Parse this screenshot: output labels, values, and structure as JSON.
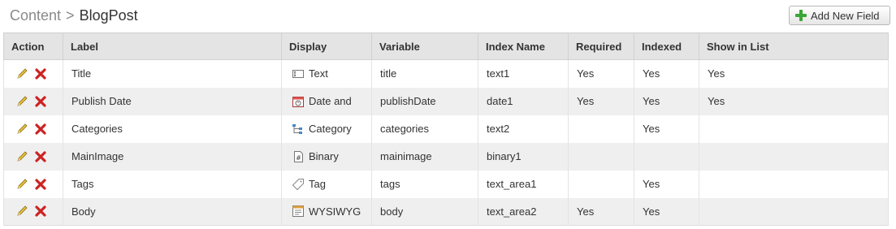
{
  "breadcrumb": {
    "root": "Content",
    "separator": ">",
    "current": "BlogPost"
  },
  "toolbar": {
    "add_new_field_label": "Add New Field",
    "add_icon": "plus-icon"
  },
  "table": {
    "headers": [
      "Action",
      "Label",
      "Display",
      "Variable",
      "Index Name",
      "Required",
      "Indexed",
      "Show in List"
    ],
    "rows": [
      {
        "label": "Title",
        "display": "Text",
        "display_icon": "text-field-icon",
        "variable": "title",
        "index_name": "text1",
        "required": "Yes",
        "indexed": "Yes",
        "show_in_list": "Yes"
      },
      {
        "label": "Publish Date",
        "display": "Date and",
        "display_icon": "calendar-icon",
        "variable": "publishDate",
        "index_name": "date1",
        "required": "Yes",
        "indexed": "Yes",
        "show_in_list": "Yes"
      },
      {
        "label": "Categories",
        "display": "Category",
        "display_icon": "category-tree-icon",
        "variable": "categories",
        "index_name": "text2",
        "required": "",
        "indexed": "Yes",
        "show_in_list": ""
      },
      {
        "label": "MainImage",
        "display": "Binary",
        "display_icon": "binary-file-icon",
        "variable": "mainimage",
        "index_name": "binary1",
        "required": "",
        "indexed": "",
        "show_in_list": ""
      },
      {
        "label": "Tags",
        "display": "Tag",
        "display_icon": "tag-icon",
        "variable": "tags",
        "index_name": "text_area1",
        "required": "",
        "indexed": "Yes",
        "show_in_list": ""
      },
      {
        "label": "Body",
        "display": "WYSIWYG",
        "display_icon": "wysiwyg-icon",
        "variable": "body",
        "index_name": "text_area2",
        "required": "Yes",
        "indexed": "Yes",
        "show_in_list": ""
      }
    ]
  },
  "colors": {
    "header_bg": "#e4e4e4",
    "stripe_bg": "#efefef",
    "plus_green": "#3aa635",
    "delete_red": "#cc2222",
    "pencil_yellow": "#e8c13a"
  }
}
